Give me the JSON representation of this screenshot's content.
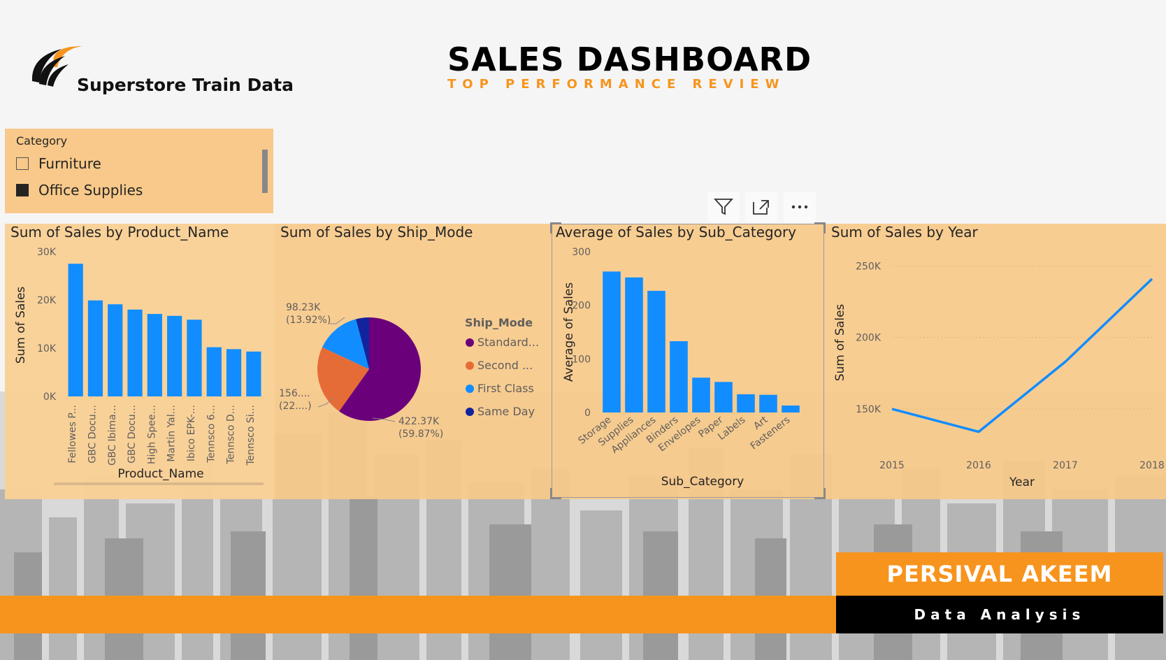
{
  "header": {
    "logo_text": "Superstore Train Data",
    "title": "SALES DASHBOARD",
    "subtitle": "TOP PERFORMANCE REVIEW"
  },
  "slicer": {
    "title": "Category",
    "items": [
      {
        "label": "Furniture",
        "checked": false
      },
      {
        "label": "Office Supplies",
        "checked": true
      }
    ]
  },
  "visual_header_icons": [
    "filter-icon",
    "focus-mode-icon",
    "more-options-icon"
  ],
  "colors": {
    "accent": "#f7941d",
    "panel_bg": "#f8c98a",
    "bar": "#118dff",
    "pie_standard": "#6b007b",
    "pie_second": "#e66c37",
    "pie_first": "#118dff",
    "pie_sameday": "#12239e"
  },
  "footer": {
    "name": "PERSIVAL AKEEM",
    "role": "Data Analysis"
  },
  "chart_data": [
    {
      "type": "bar",
      "title": "Sum of Sales by Product_Name",
      "xlabel": "Product_Name",
      "ylabel": "Sum of Sales",
      "ylim": [
        0,
        30000
      ],
      "yticks": [
        "0K",
        "10K",
        "20K",
        "30K"
      ],
      "categories": [
        "Fellowes P...",
        "GBC Docu...",
        "GBC Ibima...",
        "GBC Docu...",
        "High Spee...",
        "Martin Yal...",
        "Ibico EPK-...",
        "Tennsco 6...",
        "Tennsco D...",
        "Tennsco Si..."
      ],
      "values": [
        27500,
        19900,
        19100,
        18000,
        17100,
        16700,
        15900,
        10200,
        9800,
        9300
      ]
    },
    {
      "type": "pie",
      "title": "Sum of Sales by Ship_Mode",
      "legend_title": "Ship_Mode",
      "legend": [
        "Standard...",
        "Second ...",
        "First Class",
        "Same Day"
      ],
      "series": [
        {
          "name": "Standard Class",
          "value": 422370,
          "label": "422.37K",
          "pct": "(59.87%)"
        },
        {
          "name": "Second Class",
          "value": 156000,
          "label": "156....",
          "pct": "(22....)"
        },
        {
          "name": "First Class",
          "value": 98230,
          "label": "98.23K",
          "pct": "(13.92%)"
        },
        {
          "name": "Same Day",
          "value": 29000,
          "label": "",
          "pct": ""
        }
      ]
    },
    {
      "type": "bar",
      "title": "Average of Sales by Sub_Category",
      "xlabel": "Sub_Category",
      "ylabel": "Average of Sales",
      "ylim": [
        0,
        300
      ],
      "yticks": [
        "0",
        "100",
        "200",
        "300"
      ],
      "categories": [
        "Storage",
        "Supplies",
        "Appliances",
        "Binders",
        "Envelopes",
        "Paper",
        "Labels",
        "Art",
        "Fasteners"
      ],
      "values": [
        263,
        252,
        227,
        133,
        65,
        57,
        34,
        33,
        13
      ]
    },
    {
      "type": "line",
      "title": "Sum of Sales by Year",
      "xlabel": "Year",
      "ylabel": "Sum of Sales",
      "x": [
        "2015",
        "2016",
        "2017",
        "2018"
      ],
      "values": [
        150000,
        134000,
        183000,
        241000
      ],
      "ylim": [
        125000,
        260000
      ],
      "yticks": [
        "150K",
        "200K",
        "250K"
      ],
      "ytick_values": [
        150000,
        200000,
        250000
      ]
    }
  ]
}
